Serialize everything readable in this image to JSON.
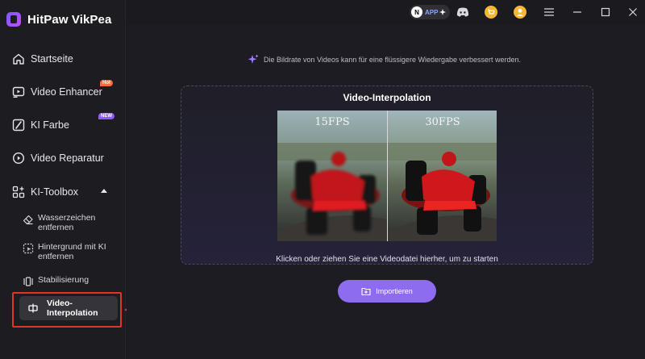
{
  "app": {
    "name": "HitPaw VikPea"
  },
  "sidebar": {
    "items": [
      {
        "label": "Startseite"
      },
      {
        "label": "Video Enhancer",
        "badge": "Hot"
      },
      {
        "label": "KI Farbe",
        "badge": "NEW"
      },
      {
        "label": "Video Reparatur"
      },
      {
        "label": "KI-Toolbox"
      }
    ],
    "sub_items": [
      {
        "label": "Wasserzeichen entfernen"
      },
      {
        "label": "Hintergrund mit KI entfernen"
      },
      {
        "label": "Stabilisierung"
      },
      {
        "label": "Video-Interpolation"
      }
    ]
  },
  "topbar": {
    "app_label": "APP",
    "app_letter": "N"
  },
  "main": {
    "hint": "Die Bildrate von Videos kann für eine flüssigere Wiedergabe verbessert werden.",
    "title": "Video-Interpolation",
    "fps_left": "15FPS",
    "fps_right": "30FPS",
    "drop_text": "Klicken oder ziehen Sie eine Videodatei hierher, um zu starten",
    "import_label": "Importieren"
  },
  "colors": {
    "accent": "#8d6cf0",
    "highlight": "#e0352b",
    "hot_badge": "#ff6a3d",
    "new_badge": "#8c5bff"
  }
}
